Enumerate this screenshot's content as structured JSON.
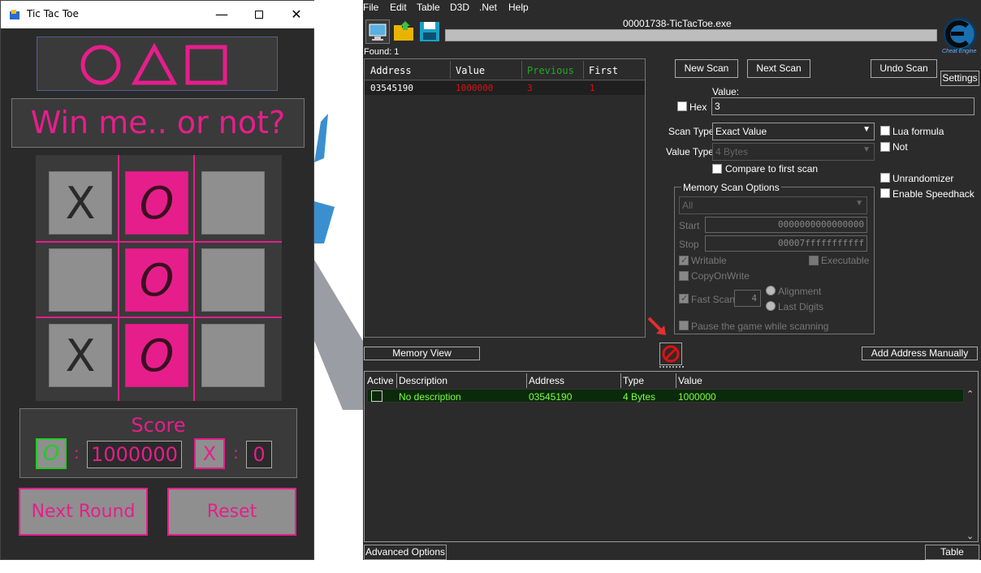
{
  "ttt": {
    "title": "Tic Tac Toe",
    "heading": "Win me.. or not?",
    "board": [
      "X",
      "O",
      "",
      "",
      "O",
      "",
      "X",
      "O",
      ""
    ],
    "score_title": "Score",
    "o_symbol": "O",
    "x_symbol": "X",
    "colon": ":",
    "o_score": "1000000",
    "x_score": "0",
    "next_round_label": "Next Round",
    "reset_label": "Reset",
    "colors": {
      "accent": "#e61e8c",
      "cell": "#8f8f8f",
      "background": "#2a2a2a",
      "o_score_border": "#22cc22"
    }
  },
  "ce": {
    "menu": [
      "File",
      "Edit",
      "Table",
      "D3D",
      ".Net",
      "Help"
    ],
    "process_title": "00001738-TicTacToe.exe",
    "found": "Found: 1",
    "scan_columns": [
      "Address",
      "Value",
      "Previous",
      "First"
    ],
    "scan_rows": [
      {
        "address": "03545190",
        "value": "1000000",
        "previous": "3",
        "first": "1"
      }
    ],
    "new_scan": "New Scan",
    "next_scan": "Next Scan",
    "undo_scan": "Undo Scan",
    "settings": "Settings",
    "value_label": "Value:",
    "hex_label": "Hex",
    "value_input": "3",
    "scan_type_label": "Scan Type",
    "scan_type_value": "Exact Value",
    "value_type_label": "Value Type",
    "value_type_value": "4 Bytes",
    "compare_first": "Compare to first scan",
    "lua_formula": "Lua formula",
    "not_label": "Not",
    "unrandomizer": "Unrandomizer",
    "enable_speedhack": "Enable Speedhack",
    "memory_scan_options": "Memory Scan Options",
    "region_value": "All",
    "start_label": "Start",
    "start_value": "0000000000000000",
    "stop_label": "Stop",
    "stop_value": "00007fffffffffff",
    "writable": "Writable",
    "executable": "Executable",
    "copy_on_write": "CopyOnWrite",
    "fast_scan": "Fast Scan",
    "fast_scan_value": "4",
    "alignment": "Alignment",
    "last_digits": "Last Digits",
    "pause_game": "Pause the game while scanning",
    "memory_view": "Memory View",
    "add_address_manually": "Add Address Manually",
    "table_columns": [
      "Active",
      "Description",
      "Address",
      "Type",
      "Value"
    ],
    "table_rows": [
      {
        "description": "No description",
        "address": "03545190",
        "type": "4 Bytes",
        "value": "1000000"
      }
    ],
    "advanced_options": "Advanced Options",
    "table_extras": "Table Extras",
    "logo_text": "Cheat Engine",
    "colors": {
      "row_text": "#7fff3f",
      "previous_header": "#22aa22",
      "scan_value": "#e01010",
      "stop_icon": "#e01010"
    }
  }
}
